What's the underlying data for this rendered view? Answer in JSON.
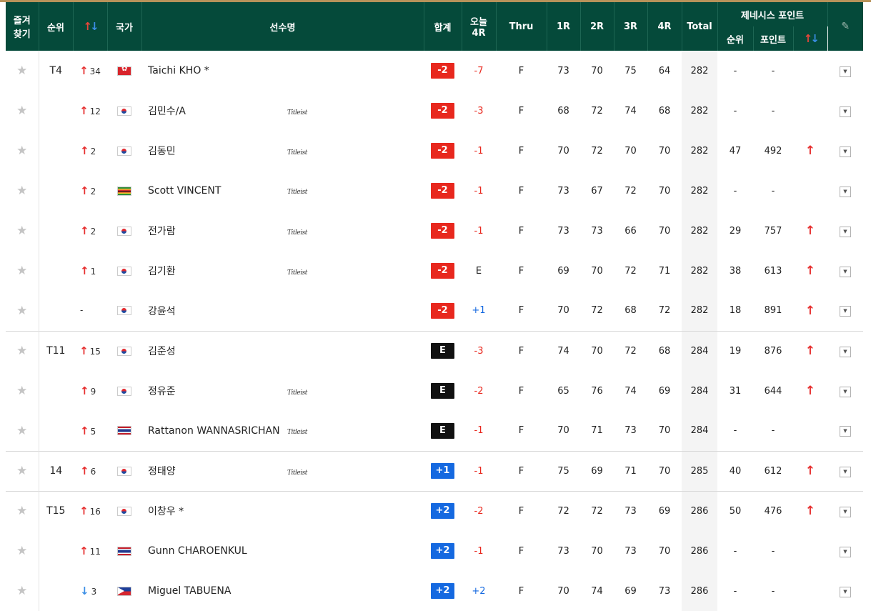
{
  "header": {
    "fav": [
      "즐겨",
      "찾기"
    ],
    "rank": "순위",
    "country": "국가",
    "player": "선수명",
    "total_score": "합계",
    "today": [
      "오늘",
      "4R"
    ],
    "thru": "Thru",
    "r1": "1R",
    "r2": "2R",
    "r3": "3R",
    "r4": "4R",
    "total": "Total",
    "genesis": "제네시스 포인트",
    "g_rank": "순위",
    "g_points": "포인트"
  },
  "rows": [
    {
      "rank": "T4",
      "move": "34",
      "dir": "up",
      "flag": "hk",
      "name": "Taichi KHO *",
      "sponsor": "",
      "score": "-2",
      "score_type": "neg",
      "today": "-7",
      "today_color": "r",
      "thru": "F",
      "r1": "73",
      "r2": "70",
      "r3": "75",
      "r4": "64",
      "total": "282",
      "grank": "-",
      "gpts": "-",
      "gup": false,
      "group_start": false
    },
    {
      "rank": "",
      "move": "12",
      "dir": "up",
      "flag": "kr",
      "name": "김민수/A",
      "sponsor": "Titleist",
      "score": "-2",
      "score_type": "neg",
      "today": "-3",
      "today_color": "r",
      "thru": "F",
      "r1": "68",
      "r2": "72",
      "r3": "74",
      "r4": "68",
      "total": "282",
      "grank": "-",
      "gpts": "-",
      "gup": false,
      "group_start": false
    },
    {
      "rank": "",
      "move": "2",
      "dir": "up",
      "flag": "kr",
      "name": "김동민",
      "sponsor": "Titleist",
      "score": "-2",
      "score_type": "neg",
      "today": "-1",
      "today_color": "r",
      "thru": "F",
      "r1": "70",
      "r2": "72",
      "r3": "70",
      "r4": "70",
      "total": "282",
      "grank": "47",
      "gpts": "492",
      "gup": true,
      "group_start": false
    },
    {
      "rank": "",
      "move": "2",
      "dir": "up",
      "flag": "zw",
      "name": "Scott VINCENT",
      "sponsor": "Titleist",
      "score": "-2",
      "score_type": "neg",
      "today": "-1",
      "today_color": "r",
      "thru": "F",
      "r1": "73",
      "r2": "67",
      "r3": "72",
      "r4": "70",
      "total": "282",
      "grank": "-",
      "gpts": "-",
      "gup": false,
      "group_start": false
    },
    {
      "rank": "",
      "move": "2",
      "dir": "up",
      "flag": "kr",
      "name": "전가람",
      "sponsor": "Titleist",
      "score": "-2",
      "score_type": "neg",
      "today": "-1",
      "today_color": "r",
      "thru": "F",
      "r1": "73",
      "r2": "73",
      "r3": "66",
      "r4": "70",
      "total": "282",
      "grank": "29",
      "gpts": "757",
      "gup": true,
      "group_start": false
    },
    {
      "rank": "",
      "move": "1",
      "dir": "up",
      "flag": "kr",
      "name": "김기환",
      "sponsor": "Titleist",
      "score": "-2",
      "score_type": "neg",
      "today": "E",
      "today_color": "k",
      "thru": "F",
      "r1": "69",
      "r2": "70",
      "r3": "72",
      "r4": "71",
      "total": "282",
      "grank": "38",
      "gpts": "613",
      "gup": true,
      "group_start": false
    },
    {
      "rank": "",
      "move": "-",
      "dir": "none",
      "flag": "kr",
      "name": "강윤석",
      "sponsor": "",
      "score": "-2",
      "score_type": "neg",
      "today": "+1",
      "today_color": "b",
      "thru": "F",
      "r1": "70",
      "r2": "72",
      "r3": "68",
      "r4": "72",
      "total": "282",
      "grank": "18",
      "gpts": "891",
      "gup": true,
      "group_start": false
    },
    {
      "rank": "T11",
      "move": "15",
      "dir": "up",
      "flag": "kr",
      "name": "김준성",
      "sponsor": "",
      "score": "E",
      "score_type": "even",
      "today": "-3",
      "today_color": "r",
      "thru": "F",
      "r1": "74",
      "r2": "70",
      "r3": "72",
      "r4": "68",
      "total": "284",
      "grank": "19",
      "gpts": "876",
      "gup": true,
      "group_start": true
    },
    {
      "rank": "",
      "move": "9",
      "dir": "up",
      "flag": "kr",
      "name": "정유준",
      "sponsor": "Titleist",
      "score": "E",
      "score_type": "even",
      "today": "-2",
      "today_color": "r",
      "thru": "F",
      "r1": "65",
      "r2": "76",
      "r3": "74",
      "r4": "69",
      "total": "284",
      "grank": "31",
      "gpts": "644",
      "gup": true,
      "group_start": false
    },
    {
      "rank": "",
      "move": "5",
      "dir": "up",
      "flag": "th",
      "name": "Rattanon WANNASRICHAN",
      "sponsor": "Titleist",
      "score": "E",
      "score_type": "even",
      "today": "-1",
      "today_color": "r",
      "thru": "F",
      "r1": "70",
      "r2": "71",
      "r3": "73",
      "r4": "70",
      "total": "284",
      "grank": "-",
      "gpts": "-",
      "gup": false,
      "group_start": false
    },
    {
      "rank": "14",
      "move": "6",
      "dir": "up",
      "flag": "kr",
      "name": "정태양",
      "sponsor": "Titleist",
      "score": "+1",
      "score_type": "pos",
      "today": "-1",
      "today_color": "r",
      "thru": "F",
      "r1": "75",
      "r2": "69",
      "r3": "71",
      "r4": "70",
      "total": "285",
      "grank": "40",
      "gpts": "612",
      "gup": true,
      "group_start": true
    },
    {
      "rank": "T15",
      "move": "16",
      "dir": "up",
      "flag": "kr",
      "name": "이창우 *",
      "sponsor": "",
      "score": "+2",
      "score_type": "pos",
      "today": "-2",
      "today_color": "r",
      "thru": "F",
      "r1": "72",
      "r2": "72",
      "r3": "73",
      "r4": "69",
      "total": "286",
      "grank": "50",
      "gpts": "476",
      "gup": true,
      "group_start": true
    },
    {
      "rank": "",
      "move": "11",
      "dir": "up",
      "flag": "th",
      "name": "Gunn CHAROENKUL",
      "sponsor": "",
      "score": "+2",
      "score_type": "pos",
      "today": "-1",
      "today_color": "r",
      "thru": "F",
      "r1": "73",
      "r2": "70",
      "r3": "73",
      "r4": "70",
      "total": "286",
      "grank": "-",
      "gpts": "-",
      "gup": false,
      "group_start": false
    },
    {
      "rank": "",
      "move": "3",
      "dir": "down",
      "flag": "ph",
      "name": "Miguel TABUENA",
      "sponsor": "",
      "score": "+2",
      "score_type": "pos",
      "today": "+2",
      "today_color": "b",
      "thru": "F",
      "r1": "70",
      "r2": "74",
      "r3": "69",
      "r4": "73",
      "total": "286",
      "grank": "-",
      "gpts": "-",
      "gup": false,
      "group_start": false
    }
  ]
}
